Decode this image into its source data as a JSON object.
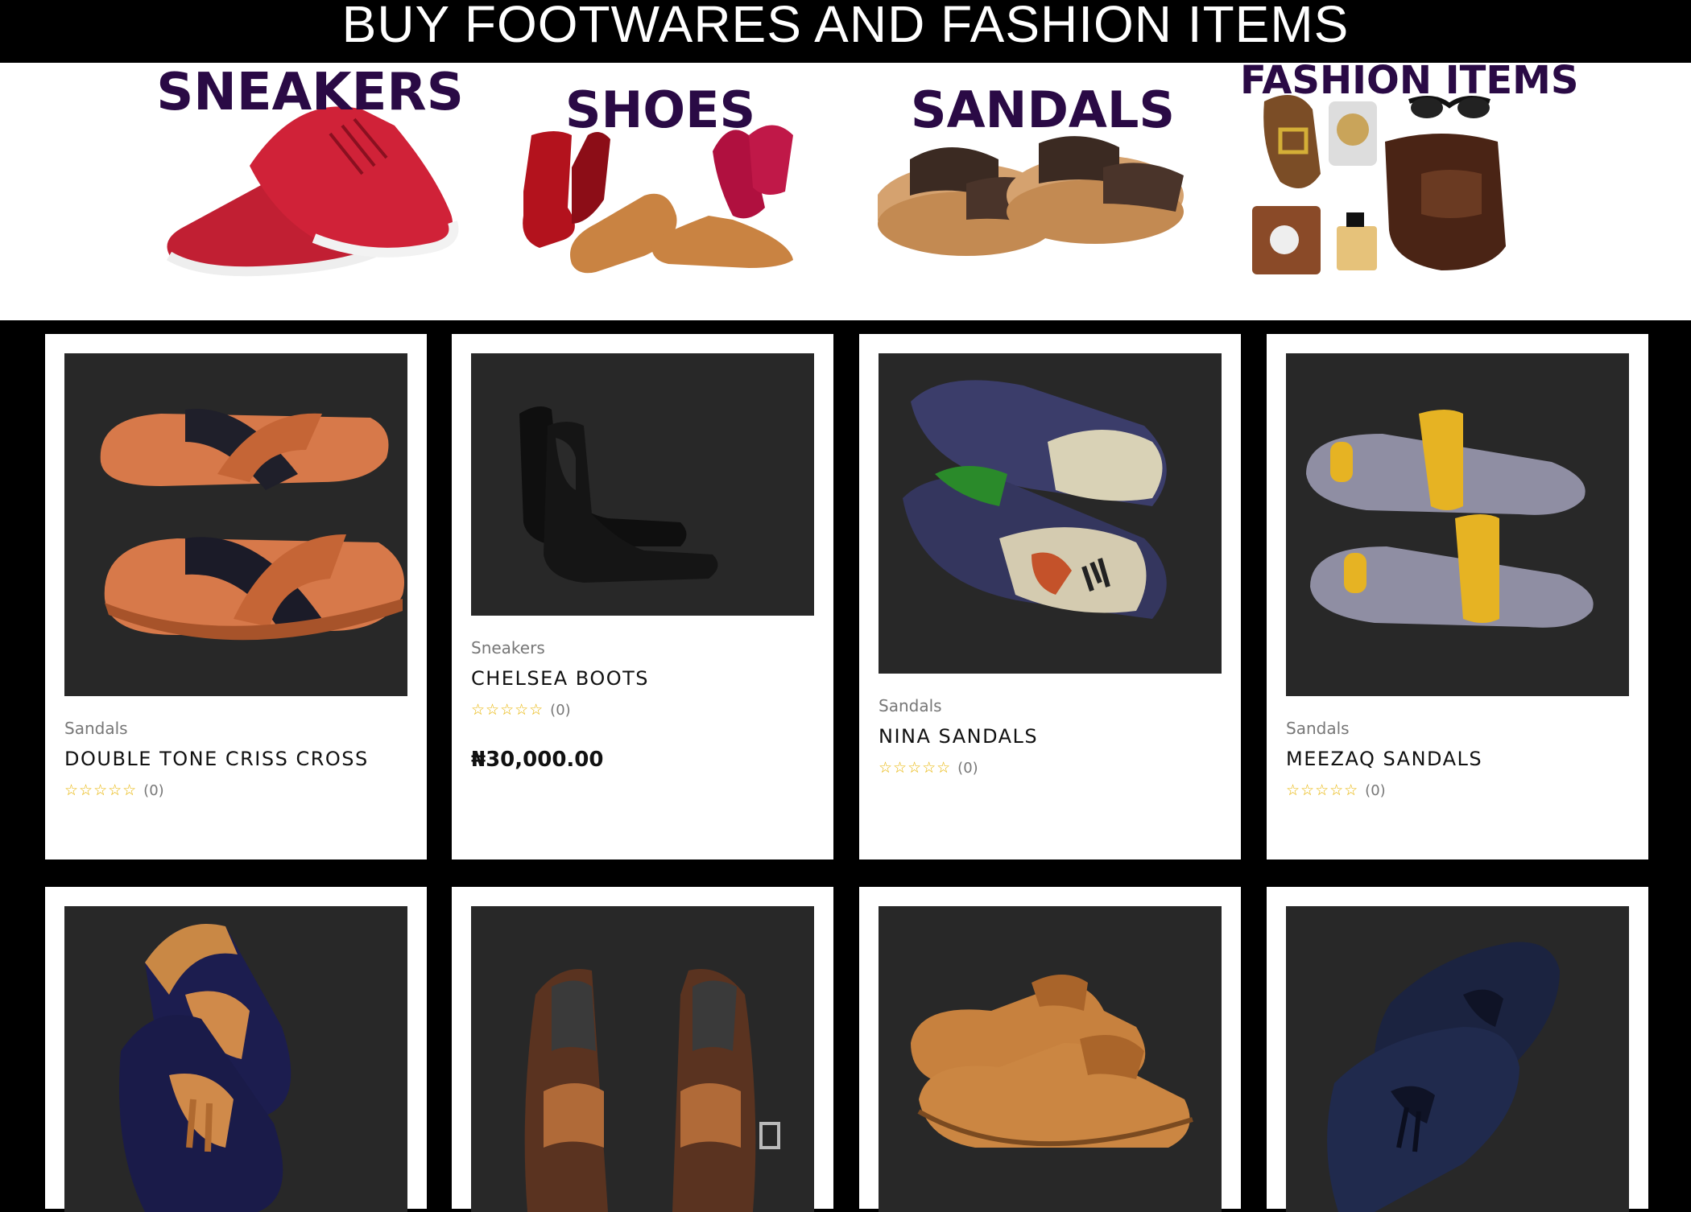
{
  "banner": {
    "title": "BUY FOOTWARES AND FASHION ITEMS"
  },
  "categories": [
    {
      "label": "SNEAKERS",
      "icon": "red-sneakers-image"
    },
    {
      "label": "SHOES",
      "icon": "assorted-shoes-image"
    },
    {
      "label": "SANDALS",
      "icon": "brown-sandals-image"
    },
    {
      "label": "FASHION ITEMS",
      "icon": "fashion-accessories-image"
    }
  ],
  "products": [
    {
      "category": "Sandals",
      "name": "DOUBLE TONE CRISS CROSS",
      "stars": "☆☆☆☆☆",
      "count": "(0)",
      "icon": "criss-cross-sandals-image"
    },
    {
      "category": "Sneakers",
      "name": "CHELSEA BOOTS",
      "stars": "☆☆☆☆☆",
      "count": "(0)",
      "price": "₦30,000.00",
      "icon": "chelsea-boots-image"
    },
    {
      "category": "Sandals",
      "name": "NINA SANDALS",
      "stars": "☆☆☆☆☆",
      "count": "(0)",
      "icon": "nina-sandals-image"
    },
    {
      "category": "Sandals",
      "name": "MEEZAQ SANDALS",
      "stars": "☆☆☆☆☆",
      "count": "(0)",
      "icon": "meezaq-sandals-image"
    },
    {
      "icon": "velvet-tassel-loafers-image"
    },
    {
      "icon": "brown-monk-strap-shoes-image"
    },
    {
      "icon": "tan-brogue-oxfords-image"
    },
    {
      "icon": "navy-woven-loafers-image"
    }
  ],
  "colors": {
    "accent": "#2a0a45",
    "star": "#e8b400",
    "thumb_bg": "#282828"
  }
}
